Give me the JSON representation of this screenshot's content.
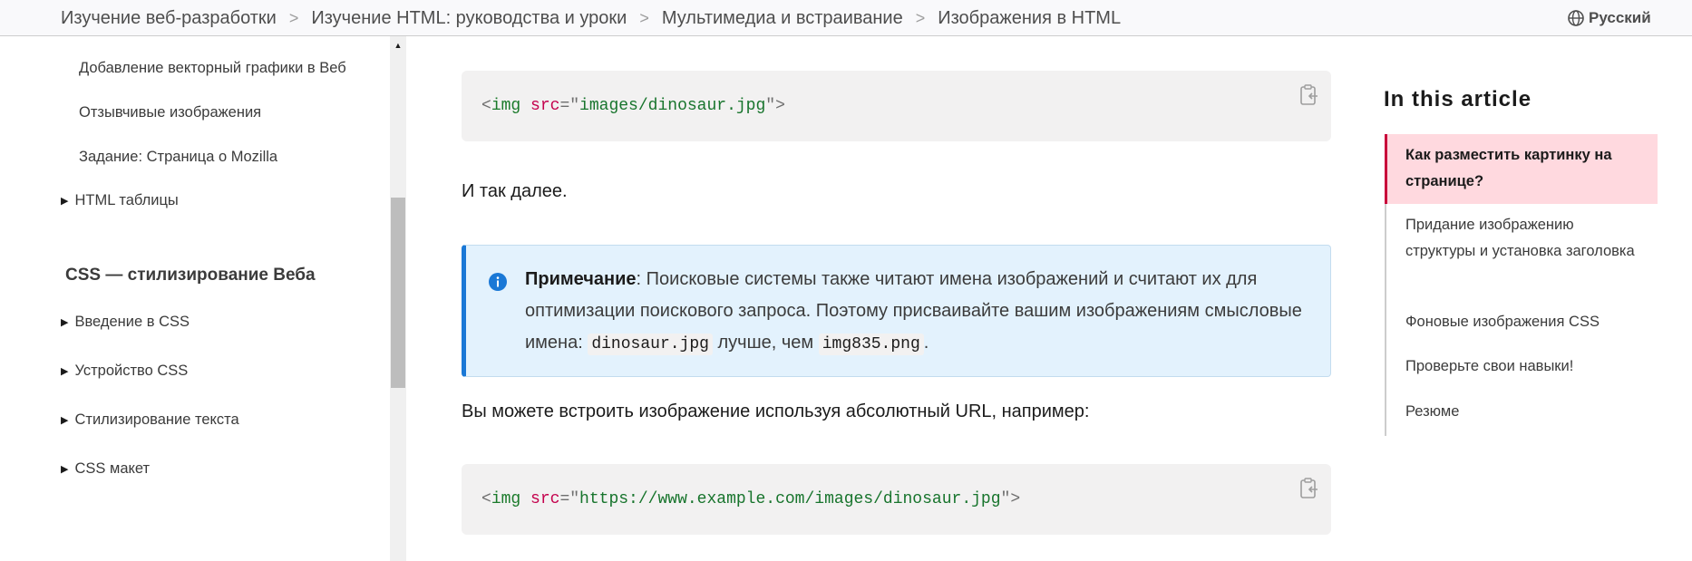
{
  "breadcrumb": {
    "items": [
      "Изучение веб-разработки",
      "Изучение HTML: руководства и уроки",
      "Мультимедиа и встраивание",
      "Изображения в HTML"
    ],
    "separator": ">"
  },
  "language": {
    "label": "Русский"
  },
  "sidebar": {
    "sub_items": [
      "Добавление векторный графики в Веб",
      "Отзывчивые изображения",
      "Задание: Страница о Mozilla"
    ],
    "group_html_tables": "HTML таблицы",
    "section_heading": "CSS — стилизирование Веба",
    "groups": [
      "Введение в CSS",
      "Устройство CSS",
      "Стилизирование текста",
      "CSS макет"
    ]
  },
  "article": {
    "code1": {
      "open": "<",
      "tag": "img",
      "attr": "src",
      "eq": "=\"",
      "value": "images/dinosaur.jpg",
      "close": "\">"
    },
    "para1": "И так далее.",
    "note": {
      "label": "Примечание",
      "text_part1": ": Поисковые системы также читают имена изображений и считают их для оптимизации поискового запроса. Поэтому присваивайте вашим изображениям смысловые имена: ",
      "code_a": "dinosaur.jpg",
      "text_part2": " лучше, чем ",
      "code_b": "img835.png",
      "text_part3": "."
    },
    "para2": "Вы можете встроить изображение используя абсолютный URL, например:",
    "code2": {
      "open": "<",
      "tag": "img",
      "attr": "src",
      "eq": "=\"",
      "value": "https://www.example.com/images/dinosaur.jpg",
      "close": "\">"
    }
  },
  "toc": {
    "title": "In this article",
    "items": [
      "Как разместить картинку на странице?",
      "Придание изображению структуры и установка заголовка",
      "Фоновые изображения CSS",
      "Проверьте свои навыки!",
      "Резюме"
    ]
  },
  "colors": {
    "accent_note": "#1a78d6",
    "toc_active_bg": "#ffd9df",
    "toc_active_border": "#c9003a",
    "code_bg": "#f2f1f1"
  },
  "icons": {
    "language": "globe-icon",
    "copy": "clipboard-copy-icon",
    "note": "info-icon"
  }
}
